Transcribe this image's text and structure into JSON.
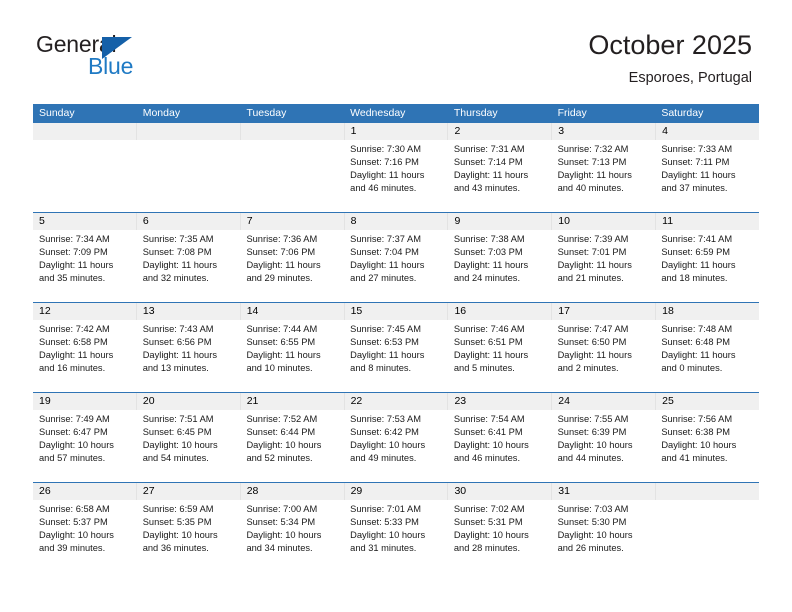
{
  "brand": {
    "name_part1": "General",
    "name_part2": "Blue",
    "accent_color": "#1560a8",
    "text_color": "#231f20"
  },
  "header": {
    "title": "October 2025",
    "subtitle": "Esporoes, Portugal"
  },
  "theme": {
    "header_blue": "#2f74b5",
    "daynum_band": "#f0f0f0"
  },
  "weekdays": [
    "Sunday",
    "Monday",
    "Tuesday",
    "Wednesday",
    "Thursday",
    "Friday",
    "Saturday"
  ],
  "weeks": [
    {
      "days": [
        {
          "num": "",
          "sunrise": "",
          "sunset": "",
          "daylight_a": "",
          "daylight_b": "",
          "empty": true
        },
        {
          "num": "",
          "sunrise": "",
          "sunset": "",
          "daylight_a": "",
          "daylight_b": "",
          "empty": true
        },
        {
          "num": "",
          "sunrise": "",
          "sunset": "",
          "daylight_a": "",
          "daylight_b": "",
          "empty": true
        },
        {
          "num": "1",
          "sunrise": "Sunrise: 7:30 AM",
          "sunset": "Sunset: 7:16 PM",
          "daylight_a": "Daylight: 11 hours",
          "daylight_b": "and 46 minutes.",
          "empty": false
        },
        {
          "num": "2",
          "sunrise": "Sunrise: 7:31 AM",
          "sunset": "Sunset: 7:14 PM",
          "daylight_a": "Daylight: 11 hours",
          "daylight_b": "and 43 minutes.",
          "empty": false
        },
        {
          "num": "3",
          "sunrise": "Sunrise: 7:32 AM",
          "sunset": "Sunset: 7:13 PM",
          "daylight_a": "Daylight: 11 hours",
          "daylight_b": "and 40 minutes.",
          "empty": false
        },
        {
          "num": "4",
          "sunrise": "Sunrise: 7:33 AM",
          "sunset": "Sunset: 7:11 PM",
          "daylight_a": "Daylight: 11 hours",
          "daylight_b": "and 37 minutes.",
          "empty": false
        }
      ]
    },
    {
      "days": [
        {
          "num": "5",
          "sunrise": "Sunrise: 7:34 AM",
          "sunset": "Sunset: 7:09 PM",
          "daylight_a": "Daylight: 11 hours",
          "daylight_b": "and 35 minutes.",
          "empty": false
        },
        {
          "num": "6",
          "sunrise": "Sunrise: 7:35 AM",
          "sunset": "Sunset: 7:08 PM",
          "daylight_a": "Daylight: 11 hours",
          "daylight_b": "and 32 minutes.",
          "empty": false
        },
        {
          "num": "7",
          "sunrise": "Sunrise: 7:36 AM",
          "sunset": "Sunset: 7:06 PM",
          "daylight_a": "Daylight: 11 hours",
          "daylight_b": "and 29 minutes.",
          "empty": false
        },
        {
          "num": "8",
          "sunrise": "Sunrise: 7:37 AM",
          "sunset": "Sunset: 7:04 PM",
          "daylight_a": "Daylight: 11 hours",
          "daylight_b": "and 27 minutes.",
          "empty": false
        },
        {
          "num": "9",
          "sunrise": "Sunrise: 7:38 AM",
          "sunset": "Sunset: 7:03 PM",
          "daylight_a": "Daylight: 11 hours",
          "daylight_b": "and 24 minutes.",
          "empty": false
        },
        {
          "num": "10",
          "sunrise": "Sunrise: 7:39 AM",
          "sunset": "Sunset: 7:01 PM",
          "daylight_a": "Daylight: 11 hours",
          "daylight_b": "and 21 minutes.",
          "empty": false
        },
        {
          "num": "11",
          "sunrise": "Sunrise: 7:41 AM",
          "sunset": "Sunset: 6:59 PM",
          "daylight_a": "Daylight: 11 hours",
          "daylight_b": "and 18 minutes.",
          "empty": false
        }
      ]
    },
    {
      "days": [
        {
          "num": "12",
          "sunrise": "Sunrise: 7:42 AM",
          "sunset": "Sunset: 6:58 PM",
          "daylight_a": "Daylight: 11 hours",
          "daylight_b": "and 16 minutes.",
          "empty": false
        },
        {
          "num": "13",
          "sunrise": "Sunrise: 7:43 AM",
          "sunset": "Sunset: 6:56 PM",
          "daylight_a": "Daylight: 11 hours",
          "daylight_b": "and 13 minutes.",
          "empty": false
        },
        {
          "num": "14",
          "sunrise": "Sunrise: 7:44 AM",
          "sunset": "Sunset: 6:55 PM",
          "daylight_a": "Daylight: 11 hours",
          "daylight_b": "and 10 minutes.",
          "empty": false
        },
        {
          "num": "15",
          "sunrise": "Sunrise: 7:45 AM",
          "sunset": "Sunset: 6:53 PM",
          "daylight_a": "Daylight: 11 hours",
          "daylight_b": "and 8 minutes.",
          "empty": false
        },
        {
          "num": "16",
          "sunrise": "Sunrise: 7:46 AM",
          "sunset": "Sunset: 6:51 PM",
          "daylight_a": "Daylight: 11 hours",
          "daylight_b": "and 5 minutes.",
          "empty": false
        },
        {
          "num": "17",
          "sunrise": "Sunrise: 7:47 AM",
          "sunset": "Sunset: 6:50 PM",
          "daylight_a": "Daylight: 11 hours",
          "daylight_b": "and 2 minutes.",
          "empty": false
        },
        {
          "num": "18",
          "sunrise": "Sunrise: 7:48 AM",
          "sunset": "Sunset: 6:48 PM",
          "daylight_a": "Daylight: 11 hours",
          "daylight_b": "and 0 minutes.",
          "empty": false
        }
      ]
    },
    {
      "days": [
        {
          "num": "19",
          "sunrise": "Sunrise: 7:49 AM",
          "sunset": "Sunset: 6:47 PM",
          "daylight_a": "Daylight: 10 hours",
          "daylight_b": "and 57 minutes.",
          "empty": false
        },
        {
          "num": "20",
          "sunrise": "Sunrise: 7:51 AM",
          "sunset": "Sunset: 6:45 PM",
          "daylight_a": "Daylight: 10 hours",
          "daylight_b": "and 54 minutes.",
          "empty": false
        },
        {
          "num": "21",
          "sunrise": "Sunrise: 7:52 AM",
          "sunset": "Sunset: 6:44 PM",
          "daylight_a": "Daylight: 10 hours",
          "daylight_b": "and 52 minutes.",
          "empty": false
        },
        {
          "num": "22",
          "sunrise": "Sunrise: 7:53 AM",
          "sunset": "Sunset: 6:42 PM",
          "daylight_a": "Daylight: 10 hours",
          "daylight_b": "and 49 minutes.",
          "empty": false
        },
        {
          "num": "23",
          "sunrise": "Sunrise: 7:54 AM",
          "sunset": "Sunset: 6:41 PM",
          "daylight_a": "Daylight: 10 hours",
          "daylight_b": "and 46 minutes.",
          "empty": false
        },
        {
          "num": "24",
          "sunrise": "Sunrise: 7:55 AM",
          "sunset": "Sunset: 6:39 PM",
          "daylight_a": "Daylight: 10 hours",
          "daylight_b": "and 44 minutes.",
          "empty": false
        },
        {
          "num": "25",
          "sunrise": "Sunrise: 7:56 AM",
          "sunset": "Sunset: 6:38 PM",
          "daylight_a": "Daylight: 10 hours",
          "daylight_b": "and 41 minutes.",
          "empty": false
        }
      ]
    },
    {
      "days": [
        {
          "num": "26",
          "sunrise": "Sunrise: 6:58 AM",
          "sunset": "Sunset: 5:37 PM",
          "daylight_a": "Daylight: 10 hours",
          "daylight_b": "and 39 minutes.",
          "empty": false
        },
        {
          "num": "27",
          "sunrise": "Sunrise: 6:59 AM",
          "sunset": "Sunset: 5:35 PM",
          "daylight_a": "Daylight: 10 hours",
          "daylight_b": "and 36 minutes.",
          "empty": false
        },
        {
          "num": "28",
          "sunrise": "Sunrise: 7:00 AM",
          "sunset": "Sunset: 5:34 PM",
          "daylight_a": "Daylight: 10 hours",
          "daylight_b": "and 34 minutes.",
          "empty": false
        },
        {
          "num": "29",
          "sunrise": "Sunrise: 7:01 AM",
          "sunset": "Sunset: 5:33 PM",
          "daylight_a": "Daylight: 10 hours",
          "daylight_b": "and 31 minutes.",
          "empty": false
        },
        {
          "num": "30",
          "sunrise": "Sunrise: 7:02 AM",
          "sunset": "Sunset: 5:31 PM",
          "daylight_a": "Daylight: 10 hours",
          "daylight_b": "and 28 minutes.",
          "empty": false
        },
        {
          "num": "31",
          "sunrise": "Sunrise: 7:03 AM",
          "sunset": "Sunset: 5:30 PM",
          "daylight_a": "Daylight: 10 hours",
          "daylight_b": "and 26 minutes.",
          "empty": false
        },
        {
          "num": "",
          "sunrise": "",
          "sunset": "",
          "daylight_a": "",
          "daylight_b": "",
          "empty": true
        }
      ]
    }
  ]
}
